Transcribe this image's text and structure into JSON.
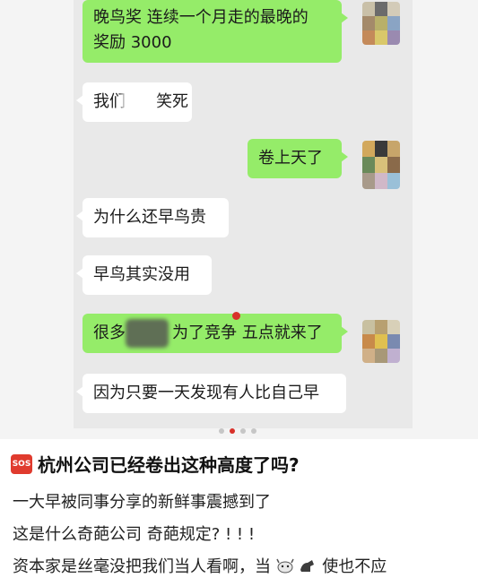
{
  "chat": {
    "messages": [
      {
        "id": "m1",
        "side": "right",
        "text_line1": "晚鸟奖 连续一个月走的最晚的",
        "text_line2": "奖励 3000"
      },
      {
        "id": "m2",
        "side": "left",
        "text_visible_start": "我们",
        "text_visible_end": "笑死"
      },
      {
        "id": "m3",
        "side": "right",
        "text": "卷上天了"
      },
      {
        "id": "m4",
        "side": "left",
        "text": "为什么还早鸟贵"
      },
      {
        "id": "m5",
        "side": "left",
        "text": "早鸟其实没用"
      },
      {
        "id": "m6",
        "side": "right",
        "text_start": "很多",
        "text_end": "为了竞争 五点就来了"
      },
      {
        "id": "m7",
        "side": "left",
        "text": "因为只要一天发现有人比自己早"
      }
    ],
    "pager": {
      "count": 4,
      "active_index": 1
    }
  },
  "post": {
    "sos_icon_label": "SOS",
    "title": "杭州公司已经卷出这种高度了吗?",
    "lines": [
      "一大早被同事分享的新鲜事震撼到了",
      "这是什么奇葩公司 奇葩规定? ! ! !",
      "资本家是丝毫没把我们当人看啊，当",
      "使也不应"
    ]
  },
  "colors": {
    "bubble_green": "#95ec69",
    "bubble_white": "#ffffff",
    "accent_red": "#d8312a"
  }
}
